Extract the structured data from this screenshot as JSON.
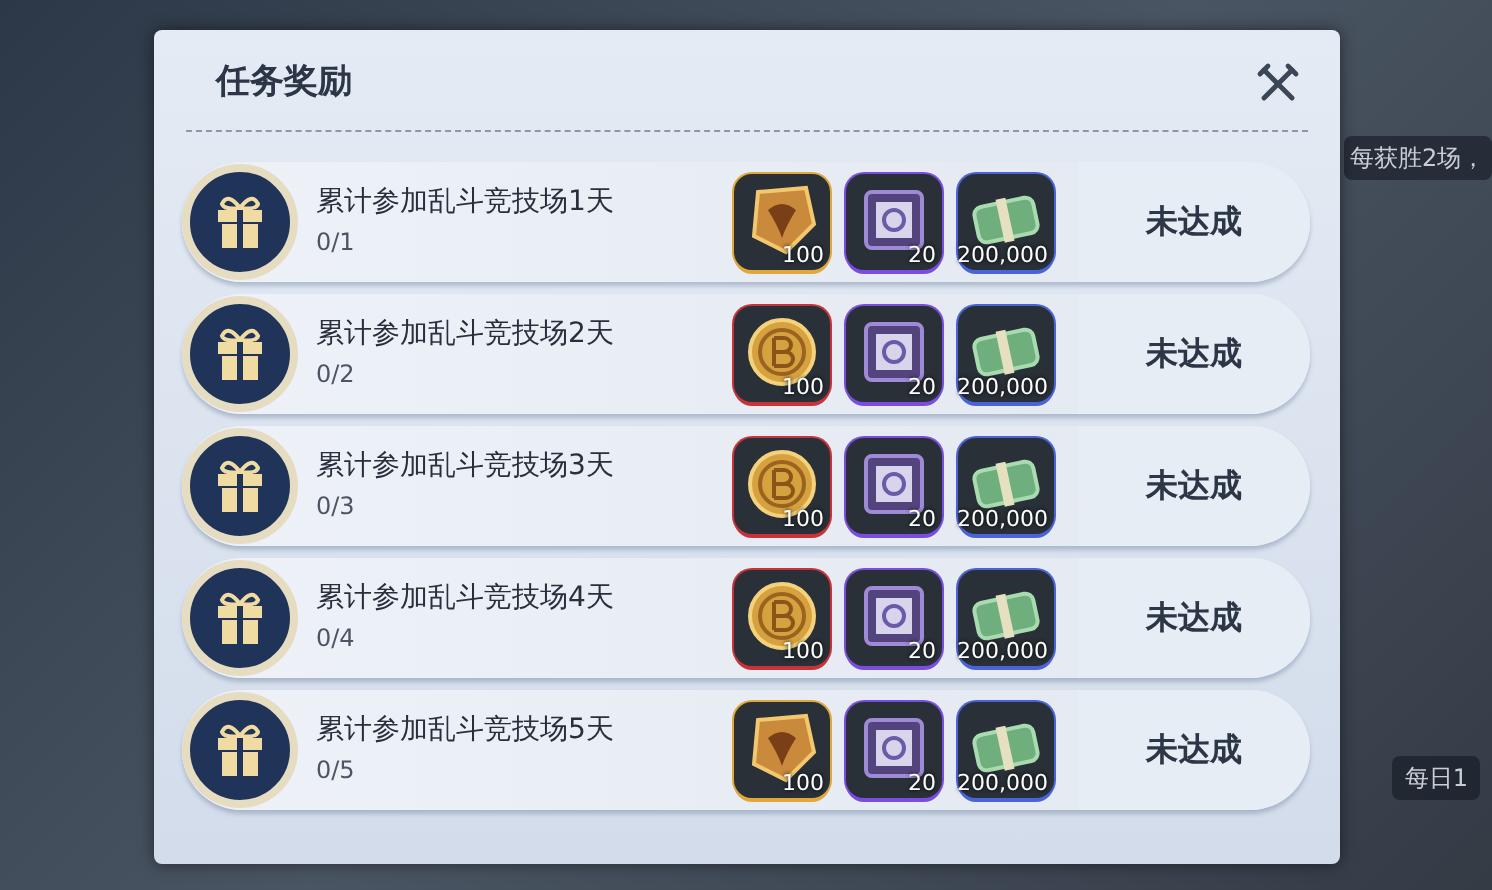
{
  "background": {
    "texts": [
      "每获胜2场，",
      "每日1"
    ]
  },
  "dialog": {
    "title": "任务奖励",
    "tasks": [
      {
        "name": "累计参加乱斗竞技场1天",
        "progress": "0/1",
        "rewards": [
          {
            "kind": "shield",
            "count": "100"
          },
          {
            "kind": "crate",
            "count": "20"
          },
          {
            "kind": "cash",
            "count": "200,000"
          }
        ],
        "status": "未达成"
      },
      {
        "name": "累计参加乱斗竞技场2天",
        "progress": "0/2",
        "rewards": [
          {
            "kind": "coin",
            "count": "100"
          },
          {
            "kind": "crate",
            "count": "20"
          },
          {
            "kind": "cash",
            "count": "200,000"
          }
        ],
        "status": "未达成"
      },
      {
        "name": "累计参加乱斗竞技场3天",
        "progress": "0/3",
        "rewards": [
          {
            "kind": "coin",
            "count": "100"
          },
          {
            "kind": "crate",
            "count": "20"
          },
          {
            "kind": "cash",
            "count": "200,000"
          }
        ],
        "status": "未达成"
      },
      {
        "name": "累计参加乱斗竞技场4天",
        "progress": "0/4",
        "rewards": [
          {
            "kind": "coin",
            "count": "100"
          },
          {
            "kind": "crate",
            "count": "20"
          },
          {
            "kind": "cash",
            "count": "200,000"
          }
        ],
        "status": "未达成"
      },
      {
        "name": "累计参加乱斗竞技场5天",
        "progress": "0/5",
        "rewards": [
          {
            "kind": "shield",
            "count": "100"
          },
          {
            "kind": "crate",
            "count": "20"
          },
          {
            "kind": "cash",
            "count": "200,000"
          }
        ],
        "status": "未达成"
      }
    ]
  }
}
